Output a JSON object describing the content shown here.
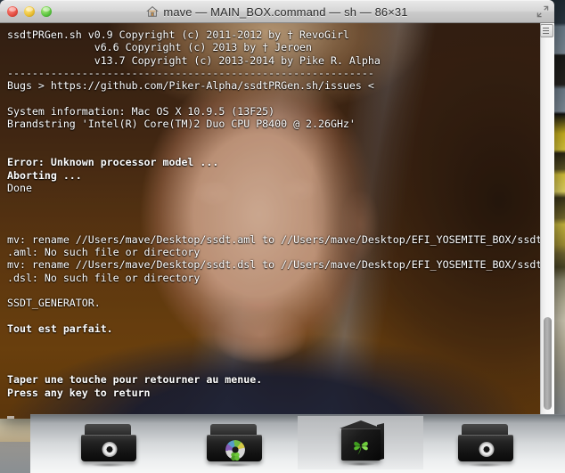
{
  "window": {
    "title": "mave — MAIN_BOX.command — sh — 86×31",
    "home_icon": "home-icon",
    "traffic_lights": [
      {
        "name": "close-button",
        "label": "Close",
        "color": "#e24b3f"
      },
      {
        "name": "minimize-button",
        "label": "Minimize",
        "color": "#e9bd2f"
      },
      {
        "name": "zoom-button",
        "label": "Zoom",
        "color": "#57c23c"
      }
    ],
    "fullscreen_icon": "fullscreen-arrows-icon"
  },
  "terminal": {
    "lines": [
      {
        "text": "ssdtPRGen.sh v0.9 Copyright (c) 2011-2012 by † RevoGirl",
        "bold": false
      },
      {
        "text": "              v6.6 Copyright (c) 2013 by † Jeroen",
        "bold": false
      },
      {
        "text": "              v13.7 Copyright (c) 2013-2014 by Pike R. Alpha",
        "bold": false
      },
      {
        "text": "-----------------------------------------------------------",
        "bold": false
      },
      {
        "text": "Bugs > https://github.com/Piker-Alpha/ssdtPRGen.sh/issues <",
        "bold": false
      },
      {
        "text": "",
        "bold": false
      },
      {
        "text": "System information: Mac OS X 10.9.5 (13F25)",
        "bold": false
      },
      {
        "text": "Brandstring 'Intel(R) Core(TM)2 Duo CPU P8400 @ 2.26GHz'",
        "bold": false
      },
      {
        "text": "",
        "bold": false
      },
      {
        "text": "",
        "bold": false
      },
      {
        "text": "Error: Unknown processor model ...",
        "bold": true
      },
      {
        "text": "Aborting ...",
        "bold": true
      },
      {
        "text": "Done",
        "bold": false
      },
      {
        "text": "",
        "bold": false
      },
      {
        "text": "",
        "bold": false
      },
      {
        "text": "",
        "bold": false
      },
      {
        "text": "mv: rename //Users/mave/Desktop/ssdt.aml to //Users/mave/Desktop/EFI_YOSEMITE_BOX/ssdt",
        "bold": false
      },
      {
        "text": ".aml: No such file or directory",
        "bold": false
      },
      {
        "text": "mv: rename //Users/mave/Desktop/ssdt.dsl to //Users/mave/Desktop/EFI_YOSEMITE_BOX/ssdt",
        "bold": false
      },
      {
        "text": ".dsl: No such file or directory",
        "bold": false
      },
      {
        "text": "",
        "bold": false
      },
      {
        "text": "SSDT_GENERATOR.",
        "bold": false
      },
      {
        "text": "",
        "bold": false
      },
      {
        "text": "Tout est parfait.",
        "bold": true
      },
      {
        "text": "",
        "bold": false
      },
      {
        "text": "",
        "bold": false
      },
      {
        "text": "",
        "bold": false
      },
      {
        "text": "Taper une touche pour retourner au menue.",
        "bold": true
      },
      {
        "text": "Press any key to return",
        "bold": true
      }
    ],
    "cursor": "block-cursor",
    "scrollbar": "vertical-scrollbar",
    "text_color": "#ffffff",
    "background_color": "#6b3f0e"
  },
  "dock": {
    "items": [
      {
        "name": "dock-item-folder-disc-1",
        "icon": "black-folder-disc-icon",
        "active": false
      },
      {
        "name": "dock-item-folder-disc-2",
        "icon": "black-folder-colored-disc-icon",
        "active": false
      },
      {
        "name": "dock-item-clover",
        "icon": "clover-cube-icon",
        "active": true
      },
      {
        "name": "dock-item-folder-disc-3",
        "icon": "black-folder-disc-icon",
        "active": false
      }
    ]
  }
}
